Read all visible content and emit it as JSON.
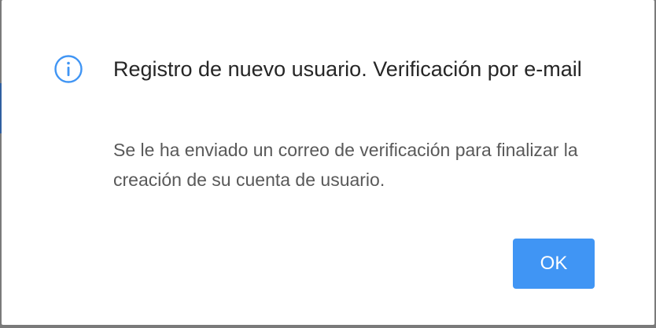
{
  "dialog": {
    "icon": "info-circle-icon",
    "title": "Registro de nuevo usuario. Verificación por e-mail",
    "message": "Se le ha enviado un correo de verificación para finalizar la creación de su cuenta de usuario.",
    "ok_label": "OK"
  },
  "colors": {
    "accent": "#4095f4",
    "title_text": "#262626",
    "body_text": "#595959"
  }
}
